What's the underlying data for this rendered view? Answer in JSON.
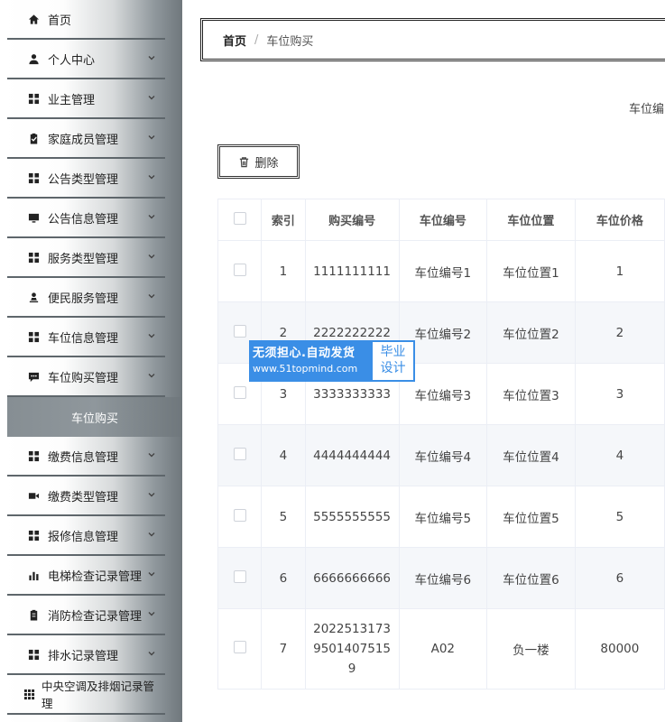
{
  "sidebar": {
    "items": [
      {
        "label": "首页",
        "icon": "home-icon",
        "chevron": false
      },
      {
        "label": "个人中心",
        "icon": "user-icon",
        "chevron": true
      },
      {
        "label": "业主管理",
        "icon": "grid-icon",
        "chevron": true
      },
      {
        "label": "家庭成员管理",
        "icon": "clipboard-check-icon",
        "chevron": true
      },
      {
        "label": "公告类型管理",
        "icon": "grid-icon",
        "chevron": true
      },
      {
        "label": "公告信息管理",
        "icon": "monitor-icon",
        "chevron": true
      },
      {
        "label": "服务类型管理",
        "icon": "grid-icon",
        "chevron": true
      },
      {
        "label": "便民服务管理",
        "icon": "person-stamp-icon",
        "chevron": true
      },
      {
        "label": "车位信息管理",
        "icon": "grid-icon",
        "chevron": true
      },
      {
        "label": "车位购买管理",
        "icon": "chat-icon",
        "chevron": true
      }
    ],
    "active_sub": "车位购买",
    "items_after": [
      {
        "label": "缴费信息管理",
        "icon": "grid-icon",
        "chevron": true
      },
      {
        "label": "缴费类型管理",
        "icon": "video-icon",
        "chevron": true
      },
      {
        "label": "报修信息管理",
        "icon": "grid-icon",
        "chevron": true
      },
      {
        "label": "电梯检查记录管理",
        "icon": "bar-chart-icon",
        "chevron": true
      },
      {
        "label": "消防检查记录管理",
        "icon": "clipboard-icon",
        "chevron": true
      },
      {
        "label": "排水记录管理",
        "icon": "grid-icon",
        "chevron": true
      },
      {
        "label": "中央空调及排烟记录管理",
        "icon": "grid-small-icon",
        "chevron": false
      }
    ]
  },
  "breadcrumb": {
    "home": "首页",
    "separator": "/",
    "current": "车位购买"
  },
  "search": {
    "label": "车位编"
  },
  "toolbar": {
    "delete_label": "删除"
  },
  "table": {
    "headers": [
      "",
      "索引",
      "购买编号",
      "车位编号",
      "车位位置",
      "车位价格"
    ],
    "rows": [
      [
        "1",
        "1111111111",
        "车位编号1",
        "车位位置1",
        "1"
      ],
      [
        "2",
        "2222222222",
        "车位编号2",
        "车位位置2",
        "2"
      ],
      [
        "3",
        "3333333333",
        "车位编号3",
        "车位位置3",
        "3"
      ],
      [
        "4",
        "4444444444",
        "车位编号4",
        "车位位置4",
        "4"
      ],
      [
        "5",
        "5555555555",
        "车位编号5",
        "车位位置5",
        "5"
      ],
      [
        "6",
        "6666666666",
        "车位编号6",
        "车位位置6",
        "6"
      ],
      [
        "7",
        "20225131739501407515 9",
        "A02",
        "负一楼",
        "80000"
      ]
    ],
    "row7_buy_lines": [
      "2022513173",
      "9501407515",
      "9"
    ]
  },
  "watermark": {
    "line1": "无须担心.自动发货",
    "line2": "www.51topmind.com",
    "badge1": "毕业",
    "badge2": "设计"
  },
  "colors": {
    "accent": "#3a8ee6",
    "sidebar_dark": "#6f777c",
    "stripe": "#f5f7fa"
  }
}
